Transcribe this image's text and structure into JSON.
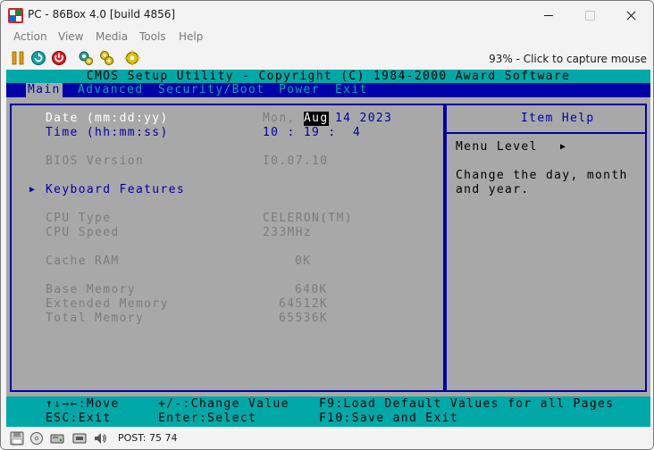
{
  "window": {
    "title": "PC - 86Box 4.0 [build 4856]"
  },
  "menu": [
    "Action",
    "View",
    "Media",
    "Tools",
    "Help"
  ],
  "toolbar": {
    "status": "93% - Click to capture mouse"
  },
  "bios": {
    "title": "CMOS Setup Utility - Copyright (C) 1984-2000 Award Software",
    "tabs": [
      "Main",
      "Advanced",
      "Security/Boot",
      "Power",
      "Exit"
    ],
    "active_tab": "Main",
    "date_label": "Date (mm:dd:yy)",
    "time_label": "Time (hh:mm:ss)",
    "date_weekday": "Mon,",
    "date_month": "Aug",
    "date_rest": "14 2023",
    "time_value": "10 : 19 :  4",
    "bios_version_label": "BIOS Version",
    "bios_version_value": "I0.07.10",
    "keyboard_marker": "▶",
    "keyboard_label": "Keyboard Features",
    "cpu_type_label": "CPU Type",
    "cpu_type_value": "CELERON(TM)",
    "cpu_speed_label": "CPU Speed",
    "cpu_speed_value": "233MHz",
    "cache_label": "Cache RAM",
    "cache_value": "0K",
    "base_mem_label": "Base Memory",
    "base_mem_value": "640K",
    "ext_mem_label": "Extended Memory",
    "ext_mem_value": "64512K",
    "total_mem_label": "Total Memory",
    "total_mem_value": "65536K",
    "help_title": "Item Help",
    "menu_level_label": "Menu Level",
    "menu_level_marker": "▶",
    "help_line1": "Change the day, month",
    "help_line2": "and year.",
    "footer": {
      "move": "↑↓→←:Move",
      "change": "+/-:Change Value",
      "f9": "F9:Load Default Values for all Pages",
      "esc": "ESC:Exit",
      "enter": "Enter:Select",
      "f10": "F10:Save and Exit"
    }
  },
  "statusbar": {
    "post": "POST: 75 74"
  }
}
